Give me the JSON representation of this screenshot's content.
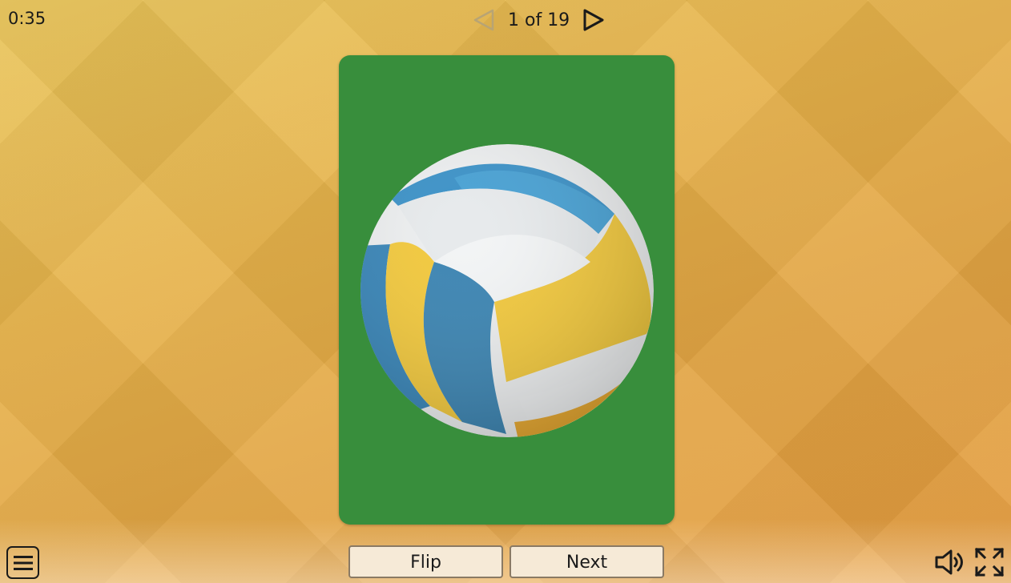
{
  "timer": "0:35",
  "pager": {
    "current": 1,
    "total": 19,
    "label": "1 of 19"
  },
  "card": {
    "background_color": "#388e3c",
    "image_icon": "volleyball-icon"
  },
  "buttons": {
    "flip_label": "Flip",
    "next_label": "Next"
  },
  "icons": {
    "prev": "triangle-left-icon",
    "next": "triangle-right-icon",
    "menu": "hamburger-menu-icon",
    "sound": "speaker-icon",
    "fullscreen": "fullscreen-expand-icon"
  },
  "colors": {
    "background": "#e6b24a",
    "button_bg": "#f6ead7",
    "text": "#1a1a1a"
  }
}
